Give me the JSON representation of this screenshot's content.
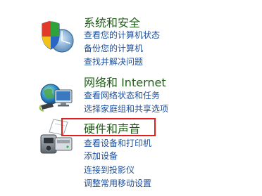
{
  "categories": [
    {
      "title": "系统和安全",
      "icon": "security-shield-icon",
      "links": [
        "查看您的计算机状态",
        "备份您的计算机",
        "查找并解决问题"
      ]
    },
    {
      "title": "网络和 Internet",
      "icon": "network-globe-icon",
      "links": [
        "查看网络状态和任务",
        "选择家庭组和共享选项"
      ]
    },
    {
      "title": "硬件和声音",
      "icon": "printer-hardware-icon",
      "links": [
        "查看设备和打印机",
        "添加设备",
        "连接到投影仪",
        "调整常用移动设置"
      ]
    }
  ],
  "colors": {
    "title": "#1e5e15",
    "link": "#1c4f9c",
    "highlight": "#e0201f"
  }
}
